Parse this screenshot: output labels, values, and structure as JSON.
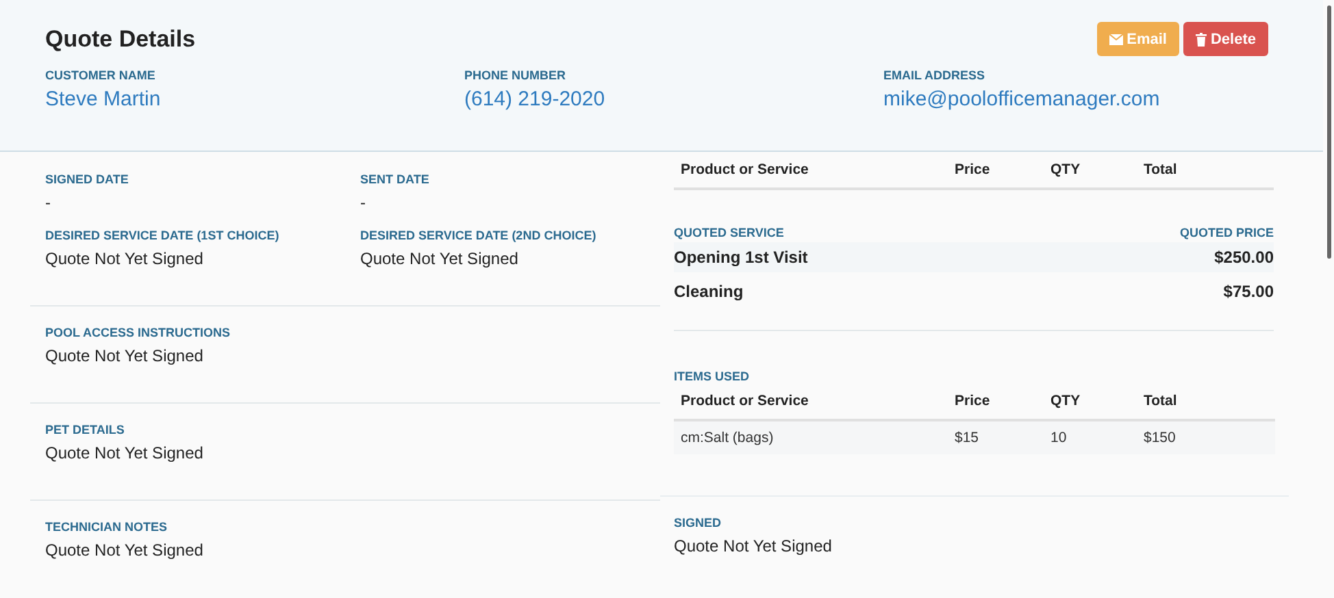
{
  "header": {
    "title": "Quote Details",
    "buttons": [
      {
        "kind": "email",
        "label": "Email"
      },
      {
        "kind": "delete",
        "label": "Delete"
      }
    ],
    "fields": [
      {
        "label": "CUSTOMER NAME",
        "value": "Steve Martin"
      },
      {
        "label": "PHONE NUMBER",
        "value": "(614) 219-2020"
      },
      {
        "label": "EMAIL ADDRESS",
        "value": "mike@poolofficemanager.com"
      }
    ]
  },
  "dates": [
    {
      "label": "SIGNED DATE",
      "value": "-"
    },
    {
      "label": "SENT DATE",
      "value": "-"
    },
    {
      "label": "DESIRED SERVICE DATE (1ST CHOICE)",
      "value": "Quote Not Yet Signed"
    },
    {
      "label": "DESIRED SERVICE DATE (2ND CHOICE)",
      "value": "Quote Not Yet Signed"
    }
  ],
  "sections": [
    {
      "label": "POOL ACCESS INSTRUCTIONS",
      "value": "Quote Not Yet Signed"
    },
    {
      "label": "PET DETAILS",
      "value": "Quote Not Yet Signed"
    },
    {
      "label": "TECHNICIAN NOTES",
      "value": "Quote Not Yet Signed"
    }
  ],
  "services_table": {
    "columns": [
      "Product or Service",
      "Price",
      "QTY",
      "Total"
    ]
  },
  "quoted": {
    "label_left": "QUOTED SERVICE",
    "label_right": "QUOTED PRICE",
    "rows": [
      {
        "name": "Opening 1st Visit",
        "price": "$250.00"
      },
      {
        "name": "Cleaning",
        "price": "$75.00"
      }
    ]
  },
  "items_used": {
    "label": "ITEMS USED",
    "columns": [
      "Product or Service",
      "Price",
      "QTY",
      "Total"
    ],
    "rows": [
      [
        "cm:Salt (bags)",
        "$15",
        "10",
        "$150"
      ]
    ]
  },
  "signed": {
    "label": "SIGNED",
    "value": "Quote Not Yet Signed"
  }
}
